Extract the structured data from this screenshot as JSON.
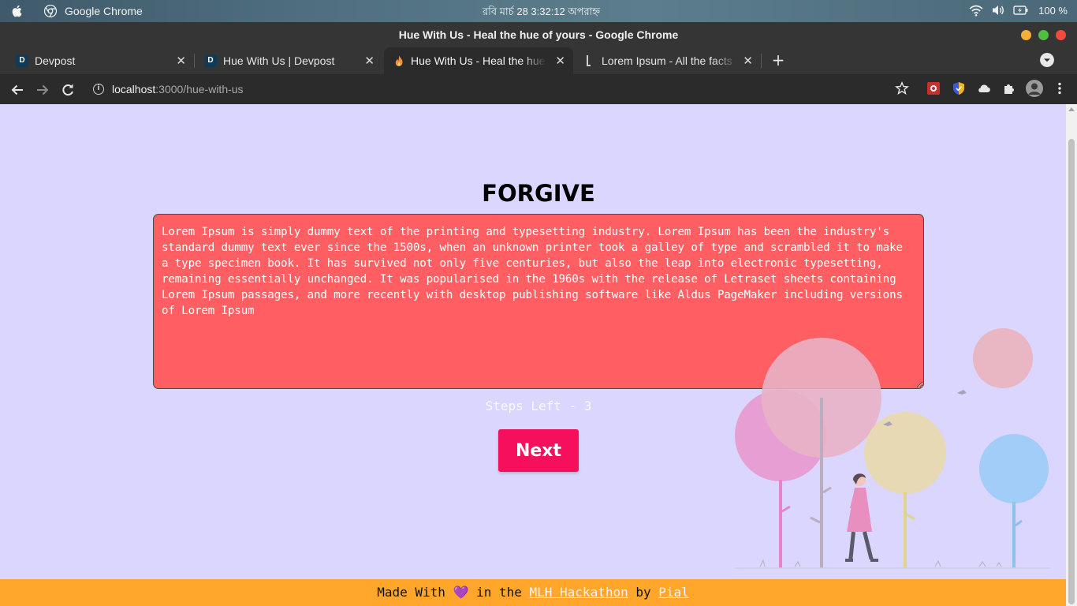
{
  "os": {
    "app_name": "Google Chrome",
    "clock": "রবি মার্চ 28   3:32:12 অপরাহ্ন",
    "battery_pct": "100 %"
  },
  "window": {
    "title": "Hue With Us - Heal the hue of yours - Google Chrome"
  },
  "tabs": [
    {
      "label": "Devpost",
      "favicon": "D",
      "close": "✕"
    },
    {
      "label": "Hue With Us | Devpost",
      "favicon": "D",
      "close": "✕"
    },
    {
      "label": "Hue With Us - Heal the hue of yours",
      "close": "✕"
    },
    {
      "label": "Lorem Ipsum - All the facts - Lipsum generator",
      "close": "✕"
    }
  ],
  "new_tab": "+",
  "omnibox": {
    "host": "localhost",
    "path": ":3000/hue-with-us"
  },
  "page": {
    "heading": "FORGIVE",
    "textarea_value": "Lorem Ipsum is simply dummy text of the printing and typesetting industry. Lorem Ipsum has been the industry's standard dummy text ever since the 1500s, when an unknown printer took a galley of type and scrambled it to make a type specimen book. It has survived not only five centuries, but also the leap into electronic typesetting, remaining essentially unchanged. It was popularised in the 1960s with the release of Letraset sheets containing Lorem Ipsum passages, and more recently with desktop publishing software like Aldus PageMaker including versions of Lorem Ipsum",
    "steps_left": "Steps Left - 3",
    "next_label": "Next"
  },
  "footer": {
    "prefix": "Made With ",
    "heart": "💜",
    "middle": " in the ",
    "link1": "MLH Hackathon",
    "by": " by ",
    "link2": "Pial"
  },
  "colors": {
    "page_bg": "#dbd6fd",
    "textarea_bg": "#ff5f62",
    "next_button": "#f50f5c",
    "footer_bg": "#ffa62b"
  }
}
